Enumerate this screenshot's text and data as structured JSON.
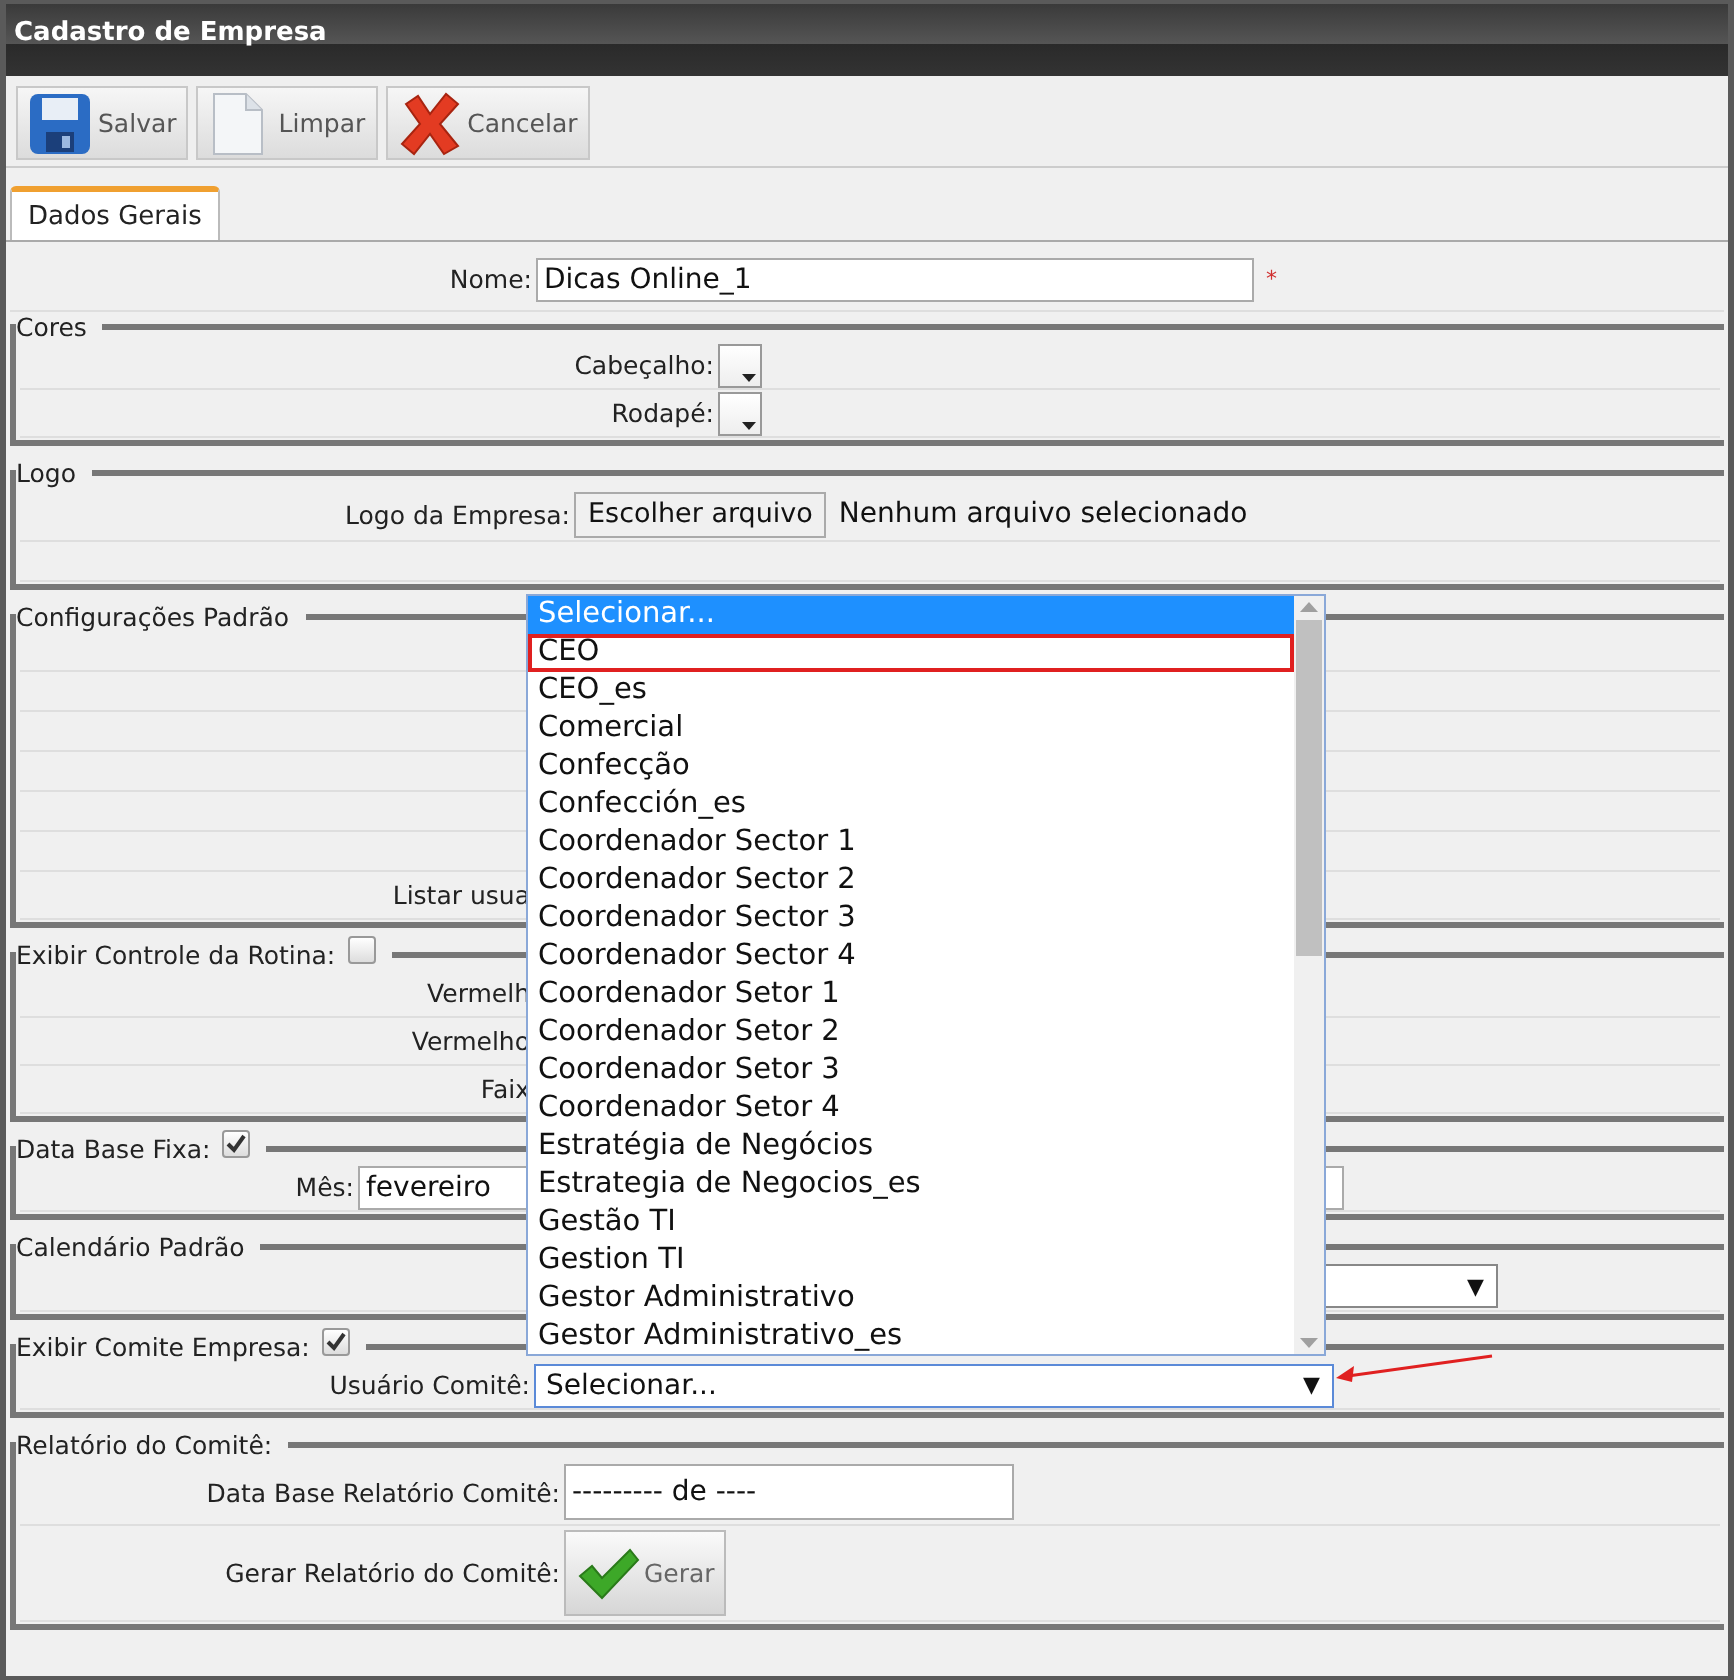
{
  "window": {
    "title": "Cadastro de Empresa"
  },
  "toolbar": [
    {
      "kind": "save",
      "label": "Salvar"
    },
    {
      "kind": "clear",
      "label": "Limpar"
    },
    {
      "kind": "cancel",
      "label": "Cancelar"
    }
  ],
  "tabs": [
    {
      "label": "Dados Gerais",
      "selected": true
    }
  ],
  "name_row": {
    "label": "Nome:",
    "value": "Dicas Online_1",
    "marker": "*"
  },
  "sections": [
    {
      "legend": "Cores",
      "rows": [
        {
          "kind": "color",
          "label": "Cabeçalho:"
        },
        {
          "kind": "color",
          "label": "Rodapé:"
        }
      ]
    },
    {
      "legend": "Logo",
      "rows": [
        {
          "kind": "file",
          "label": "Logo da Empresa:",
          "button": "Escolher arquivo",
          "status": "Nenhum arquivo selecionado"
        },
        {
          "kind": "empty"
        }
      ]
    },
    {
      "legend": "Configurações Padrão",
      "rows": [
        {
          "kind": "empty"
        },
        {
          "kind": "empty"
        },
        {
          "kind": "empty"
        },
        {
          "kind": "empty"
        },
        {
          "kind": "empty"
        },
        {
          "kind": "empty"
        },
        {
          "kind": "label",
          "label": "Listar usua"
        }
      ]
    },
    {
      "legend": "Exibir Controle da Rotina:",
      "checked": false,
      "rows": [
        {
          "kind": "label",
          "label": "Vermelh"
        },
        {
          "kind": "label",
          "label": "Vermelho"
        },
        {
          "kind": "label",
          "label": "Faix"
        }
      ]
    },
    {
      "legend": "Data Base Fixa:",
      "checked": true,
      "rows": [
        {
          "kind": "text",
          "label": "Mês:",
          "value": "fevereiro"
        }
      ]
    },
    {
      "legend": "Calendário Padrão",
      "rows": [
        {
          "kind": "select",
          "arrow": "▼"
        }
      ]
    },
    {
      "legend": "Exibir Comite Empresa:",
      "checked": true,
      "rows": [
        {
          "kind": "select",
          "label": "Usuário Comitê:",
          "value": "Selecionar...",
          "arrow": "▼",
          "focused": true
        }
      ]
    },
    {
      "legend": "Relatório do Comitê:",
      "rows": [
        {
          "kind": "text",
          "label": "Data Base Relatório Comitê:",
          "value": "--------- de ----"
        },
        {
          "kind": "button",
          "label": "Gerar Relatório do Comitê:",
          "button": "Gerar"
        }
      ]
    }
  ],
  "dropdown": {
    "options": [
      {
        "label": "Selecionar...",
        "selected": true,
        "outlined": false
      },
      {
        "label": "CEO",
        "selected": false,
        "outlined": true
      },
      {
        "label": "CEO_es",
        "selected": false,
        "outlined": false
      },
      {
        "label": "Comercial",
        "selected": false,
        "outlined": false
      },
      {
        "label": "Confecção",
        "selected": false,
        "outlined": false
      },
      {
        "label": "Confección_es",
        "selected": false,
        "outlined": false
      },
      {
        "label": "Coordenador Sector 1",
        "selected": false,
        "outlined": false
      },
      {
        "label": "Coordenador Sector 2",
        "selected": false,
        "outlined": false
      },
      {
        "label": "Coordenador Sector 3",
        "selected": false,
        "outlined": false
      },
      {
        "label": "Coordenador Sector 4",
        "selected": false,
        "outlined": false
      },
      {
        "label": "Coordenador Setor 1",
        "selected": false,
        "outlined": false
      },
      {
        "label": "Coordenador Setor 2",
        "selected": false,
        "outlined": false
      },
      {
        "label": "Coordenador Setor 3",
        "selected": false,
        "outlined": false
      },
      {
        "label": "Coordenador Setor 4",
        "selected": false,
        "outlined": false
      },
      {
        "label": "Estratégia de Negócios",
        "selected": false,
        "outlined": false
      },
      {
        "label": "Estrategia de Negocios_es",
        "selected": false,
        "outlined": false
      },
      {
        "label": "Gestão TI",
        "selected": false,
        "outlined": false
      },
      {
        "label": "Gestion TI",
        "selected": false,
        "outlined": false
      },
      {
        "label": "Gestor Administrativo",
        "selected": false,
        "outlined": false
      },
      {
        "label": "Gestor Administrativo_es",
        "selected": false,
        "outlined": false
      }
    ]
  }
}
